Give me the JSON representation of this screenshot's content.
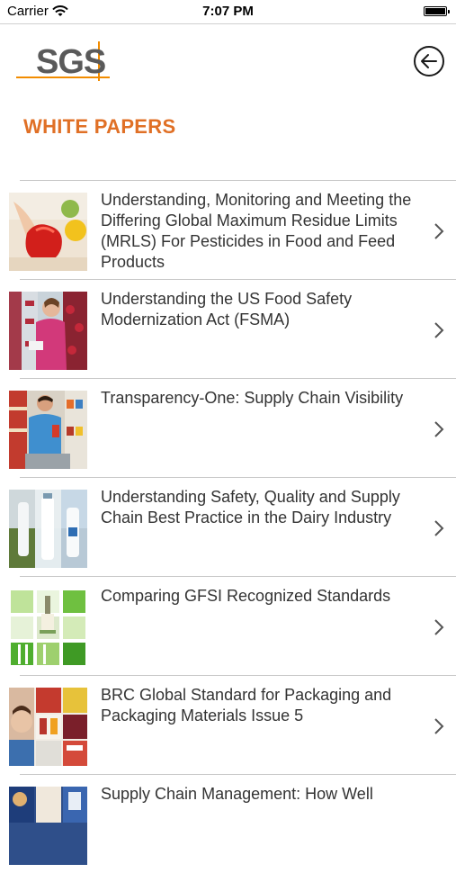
{
  "status_bar": {
    "carrier": "Carrier",
    "time": "7:07 PM"
  },
  "header": {
    "logo_text": "SGS",
    "back_icon": "arrow-left-circle-icon"
  },
  "page": {
    "title": "WHITE PAPERS"
  },
  "colors": {
    "accent": "#e07026",
    "logo_orange": "#f28c00",
    "text": "#333333",
    "divider": "#c8c8c8"
  },
  "items": [
    {
      "title": "Understanding, Monitoring and Meeting the Differing Global Maximum Residue Limits (MRLS) For Pesticides in Food and Feed Products",
      "thumbnail": "red-peppers-photo"
    },
    {
      "title": "Understanding the US Food Safety Modernization Act (FSMA)",
      "thumbnail": "grocery-shopper-photo"
    },
    {
      "title": "Transparency-One: Supply Chain Visibility",
      "thumbnail": "man-in-supermarket-photo"
    },
    {
      "title": "Understanding Safety, Quality and Supply Chain Best Practice in the Dairy Industry",
      "thumbnail": "dairy-bottles-photo"
    },
    {
      "title": "Comparing GFSI Recognized Standards",
      "thumbnail": "green-mosaic-photo"
    },
    {
      "title": "BRC Global Standard for Packaging and Packaging Materials Issue 5",
      "thumbnail": "packaging-collage-photo"
    },
    {
      "title": "Supply Chain Management: How Well",
      "thumbnail": "food-collage-photo"
    }
  ]
}
